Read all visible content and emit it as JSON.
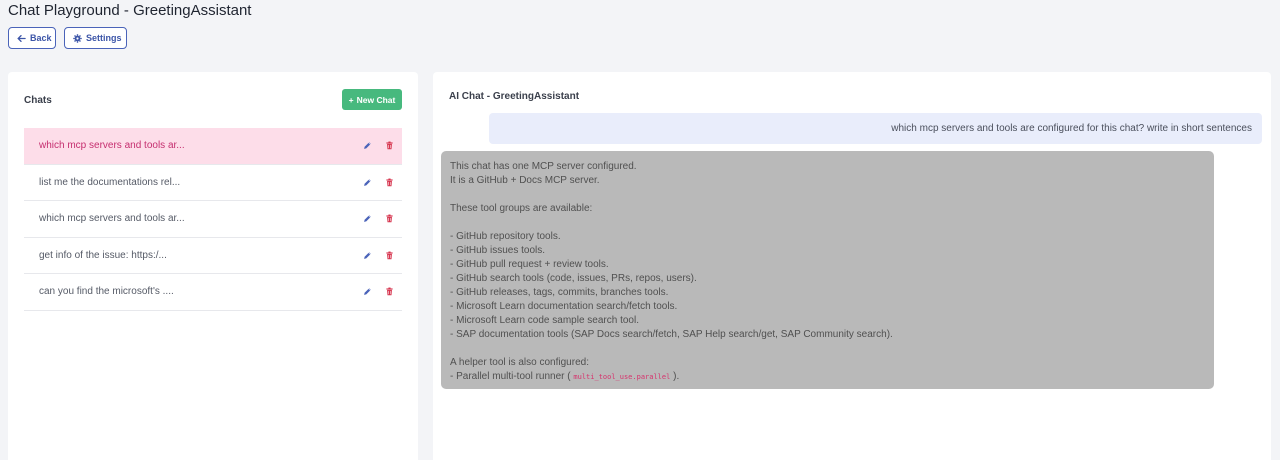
{
  "header": {
    "title": "Chat Playground - GreetingAssistant",
    "back_label": "Back",
    "settings_label": "Settings"
  },
  "sidebar": {
    "heading": "Chats",
    "new_chat_label": "New Chat",
    "items": [
      {
        "label": "which mcp servers and tools ar...",
        "active": true
      },
      {
        "label": "list me the documentations rel...",
        "active": false
      },
      {
        "label": "which mcp servers and tools ar...",
        "active": false
      },
      {
        "label": "get info of the issue: https:/...",
        "active": false
      },
      {
        "label": "can you find the microsoft's ....",
        "active": false
      }
    ]
  },
  "chat": {
    "heading": "AI Chat - GreetingAssistant",
    "user_message": "which mcp servers and tools are configured for this chat? write in short sentences",
    "assistant_lines": [
      "This chat has one MCP server configured.",
      "It is a GitHub + Docs MCP server.",
      "",
      "These tool groups are available:",
      "",
      "- GitHub repository tools.",
      "- GitHub issues tools.",
      "- GitHub pull request + review tools.",
      "- GitHub search tools (code, issues, PRs, repos, users).",
      "- GitHub releases, tags, commits, branches tools.",
      "- Microsoft Learn documentation search/fetch tools.",
      "- Microsoft Learn code sample search tool.",
      "- SAP documentation tools (SAP Docs search/fetch, SAP Help search/get, SAP Community search).",
      "",
      "A helper tool is also configured:"
    ],
    "last_line_prefix": "- Parallel multi-tool runner (",
    "last_line_code": "multi_tool_use.parallel",
    "last_line_suffix": ")."
  },
  "colors": {
    "accent": "#4a63b9",
    "new_chat_bg": "#47b97e",
    "active_row_bg": "#fddde9",
    "active_row_text": "#c52e6f",
    "edit_icon": "#4a63b9",
    "delete_icon": "#d6334d",
    "assistant_bubble": "#b9b9b9",
    "user_bubble": "#e9edfb"
  },
  "icons": {
    "back": "arrow-left-icon",
    "settings": "gear-icon",
    "new_chat": "plus-icon",
    "edit": "pencil-icon",
    "delete": "trash-icon"
  }
}
